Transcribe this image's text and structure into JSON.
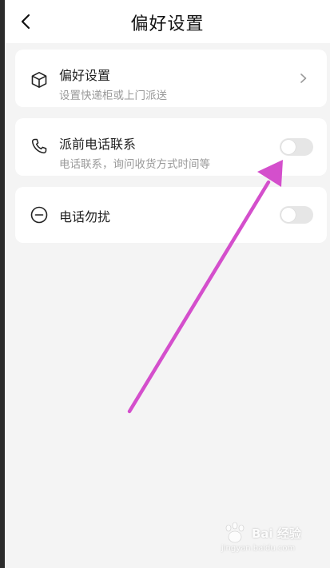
{
  "header": {
    "title": "偏好设置",
    "back_icon": "back-chevron-icon"
  },
  "rows": [
    {
      "title": "偏好设置",
      "subtitle": "设置快递柜或上门派送",
      "icon": "box-icon",
      "control": "chevron"
    },
    {
      "title": "派前电话联系",
      "subtitle": "电话联系，询问收货方式时间等",
      "icon": "phone-icon",
      "control": "toggle",
      "toggle_on": false
    },
    {
      "title": "电话勿扰",
      "icon": "minus-circle-icon",
      "control": "toggle",
      "toggle_on": false
    }
  ],
  "annotation": {
    "arrow_color": "#d44fcc"
  },
  "watermark": {
    "text": "Bai 经验",
    "sub": "jingyan.baidu.com"
  },
  "colors": {
    "background": "#f4f4f4",
    "card": "#ffffff",
    "toggle_off": "#e6e6e6"
  }
}
